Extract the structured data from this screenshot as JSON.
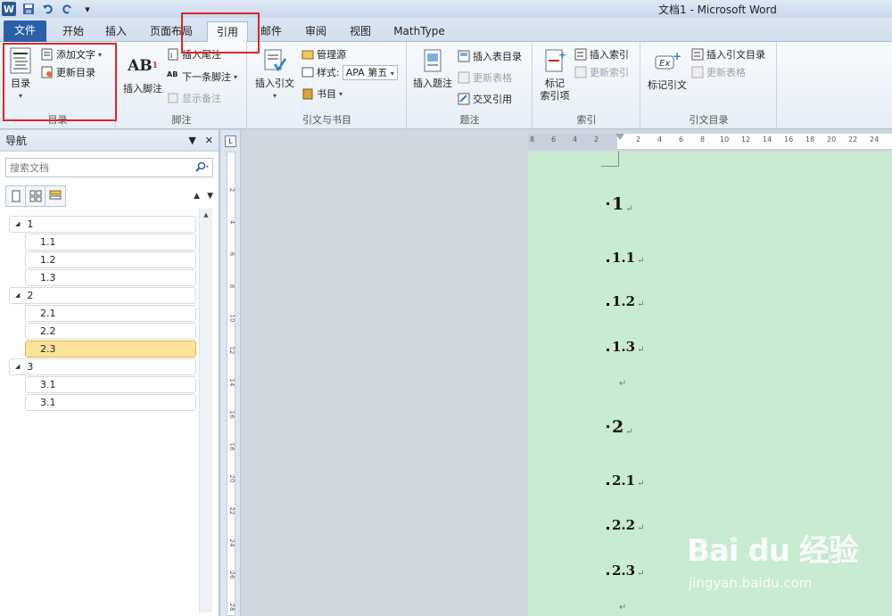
{
  "window": {
    "title": "文档1 - Microsoft Word"
  },
  "tabs": [
    {
      "label": "文件",
      "name": "tab-file"
    },
    {
      "label": "开始",
      "name": "tab-home"
    },
    {
      "label": "插入",
      "name": "tab-insert"
    },
    {
      "label": "页面布局",
      "name": "tab-page-layout"
    },
    {
      "label": "引用",
      "name": "tab-references",
      "active": true
    },
    {
      "label": "邮件",
      "name": "tab-mailings"
    },
    {
      "label": "审阅",
      "name": "tab-review"
    },
    {
      "label": "视图",
      "name": "tab-view"
    },
    {
      "label": "MathType",
      "name": "tab-mathtype"
    }
  ],
  "ribbon": {
    "toc": {
      "group": "目录",
      "toc_btn": "目录",
      "add_text": "添加文字",
      "update_toc": "更新目录"
    },
    "footnotes": {
      "group": "脚注",
      "insert_footnote": "插入脚注",
      "insert_endnote": "插入尾注",
      "next_footnote": "下一条脚注",
      "show_notes": "显示备注"
    },
    "citations": {
      "group": "引文与书目",
      "insert_citation": "插入引文",
      "manage_sources": "管理源",
      "style_label": "样式:",
      "style_value": "APA 第五",
      "bibliography": "书目"
    },
    "captions": {
      "group": "题注",
      "insert_caption": "插入题注",
      "insert_table_of_figures": "插入表目录",
      "update_table": "更新表格",
      "cross_reference": "交叉引用"
    },
    "index": {
      "group": "索引",
      "mark_entry_line1": "标记",
      "mark_entry_line2": "索引项",
      "insert_index": "插入索引",
      "update_index": "更新索引"
    },
    "authorities": {
      "group": "引文目录",
      "mark_citation": "标记引文",
      "insert_toa": "插入引文目录",
      "update_table": "更新表格"
    }
  },
  "navigation": {
    "title": "导航",
    "search_placeholder": "搜索文档",
    "items": [
      {
        "label": "1",
        "level": 1
      },
      {
        "label": "1.1",
        "level": 2
      },
      {
        "label": "1.2",
        "level": 2
      },
      {
        "label": "1.3",
        "level": 2
      },
      {
        "label": "2",
        "level": 1
      },
      {
        "label": "2.1",
        "level": 2
      },
      {
        "label": "2.2",
        "level": 2
      },
      {
        "label": "2.3",
        "level": 2,
        "selected": true
      },
      {
        "label": "3",
        "level": 1
      },
      {
        "label": "3.1",
        "level": 2
      },
      {
        "label": "3.1",
        "level": 2
      }
    ]
  },
  "rulers": {
    "horizontal": [
      "8",
      "6",
      "4",
      "2",
      "2",
      "4",
      "6",
      "8",
      "10",
      "12",
      "14",
      "16",
      "18",
      "20",
      "22",
      "24"
    ],
    "vertical": [
      "2",
      "4",
      "6",
      "8",
      "10",
      "12",
      "14",
      "16",
      "18",
      "20",
      "22",
      "24",
      "26",
      "28"
    ]
  },
  "document": {
    "headings": [
      {
        "text": "1",
        "level": 1
      },
      {
        "text": "1.1",
        "level": 2
      },
      {
        "text": "1.2",
        "level": 2
      },
      {
        "text": "1.3",
        "level": 2
      },
      {
        "text": "2",
        "level": 1
      },
      {
        "text": "2.1",
        "level": 2
      },
      {
        "text": "2.2",
        "level": 2
      },
      {
        "text": "2.3",
        "level": 2
      }
    ],
    "paragraph_mark": "↵"
  },
  "watermark": {
    "logo": "Bai du 经验",
    "url": "jingyan.baidu.com"
  },
  "colors": {
    "file_tab": "#2b5fa8",
    "highlight_box": "#d9262b",
    "page_bg": "#c8ebd1",
    "nav_selected": "#fde39a"
  }
}
